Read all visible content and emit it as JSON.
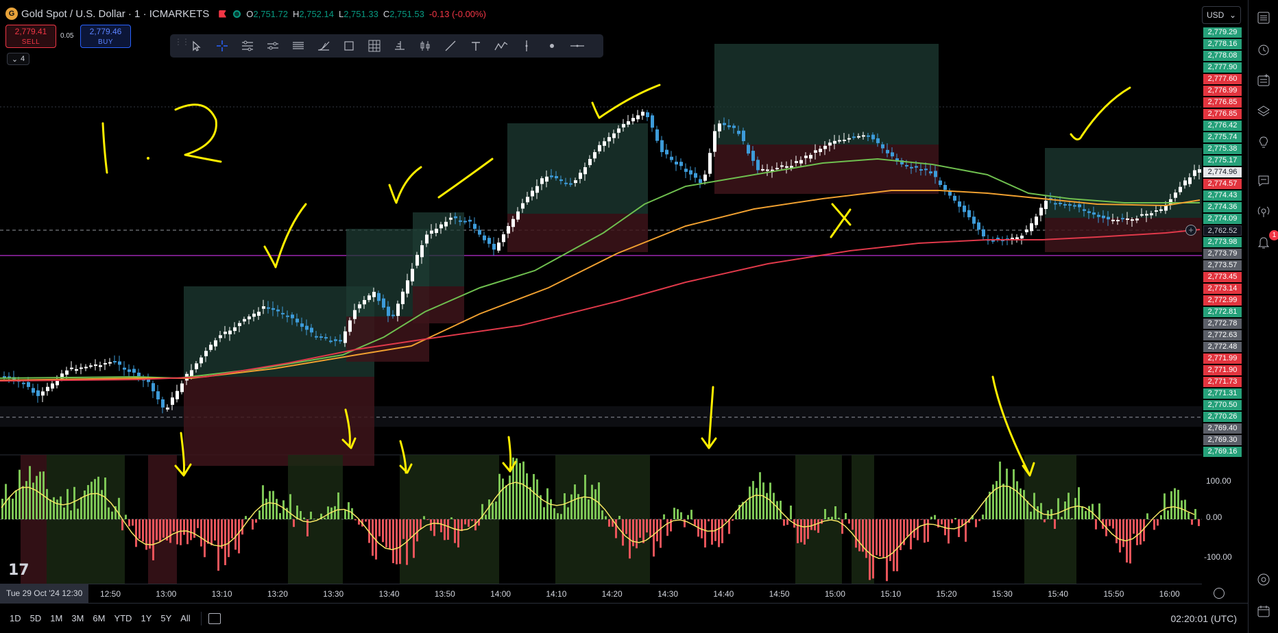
{
  "legend": {
    "symbol": "Gold Spot / U.S. Dollar · 1 · ICMARKETS",
    "open": "2,751.72",
    "high": "2,752.14",
    "low": "2,751.33",
    "close": "2,751.53",
    "change": "-0.13 (-0.00%)"
  },
  "trade": {
    "sell_price": "2,779.41",
    "sell_label": "SELL",
    "buy_price": "2,779.46",
    "buy_label": "BUY",
    "spread": "0.05",
    "collapse_count": "4"
  },
  "currency": "USD",
  "price_labels": [
    {
      "v": "2,779.29",
      "c": "g"
    },
    {
      "v": "2,778.16",
      "c": "g"
    },
    {
      "v": "2,778.08",
      "c": "g"
    },
    {
      "v": "2,777.90",
      "c": "g"
    },
    {
      "v": "2,777.60",
      "c": "r"
    },
    {
      "v": "2,776.99",
      "c": "r"
    },
    {
      "v": "2,776.85",
      "c": "r"
    },
    {
      "v": "2,776.85",
      "c": "r"
    },
    {
      "v": "2,776.42",
      "c": "g"
    },
    {
      "v": "2,775.74",
      "c": "g"
    },
    {
      "v": "2,775.38",
      "c": "g"
    },
    {
      "v": "2,775.17",
      "c": "g"
    },
    {
      "v": "2,774.96",
      "c": "w"
    },
    {
      "v": "2,774.57",
      "c": "r"
    },
    {
      "v": "2,774.43",
      "c": "g"
    },
    {
      "v": "2,774.36",
      "c": "g"
    },
    {
      "v": "2,774.09",
      "c": "g"
    },
    {
      "v": "2,762.52",
      "c": "cur"
    },
    {
      "v": "2,773.98",
      "c": "g"
    },
    {
      "v": "2,773.79",
      "c": "k"
    },
    {
      "v": "2,773.57",
      "c": "k"
    },
    {
      "v": "2,773.45",
      "c": "r"
    },
    {
      "v": "2,773.14",
      "c": "r"
    },
    {
      "v": "2,772.99",
      "c": "r"
    },
    {
      "v": "2,772.81",
      "c": "g"
    },
    {
      "v": "2,772.78",
      "c": "k"
    },
    {
      "v": "2,772.63",
      "c": "k"
    },
    {
      "v": "2,772.48",
      "c": "k"
    },
    {
      "v": "2,771.99",
      "c": "r"
    },
    {
      "v": "2,771.90",
      "c": "r"
    },
    {
      "v": "2,771.73",
      "c": "r"
    },
    {
      "v": "2,771.31",
      "c": "g"
    },
    {
      "v": "2,770.50",
      "c": "g"
    },
    {
      "v": "2,770.26",
      "c": "g"
    },
    {
      "v": "2,769.40",
      "c": "k"
    },
    {
      "v": "2,769.30",
      "c": "k"
    },
    {
      "v": "2,769.16",
      "c": "g"
    }
  ],
  "osc_axis": {
    "top": "100.00",
    "mid": "0.00",
    "bottom": "-100.00"
  },
  "time_axis": {
    "first": "Tue 29 Oct '24   12:30",
    "labels": [
      "12:50",
      "13:00",
      "13:10",
      "13:20",
      "13:30",
      "13:40",
      "13:50",
      "14:00",
      "14:10",
      "14:20",
      "14:30",
      "14:40",
      "14:50",
      "15:00",
      "15:10",
      "15:20",
      "15:30",
      "15:40",
      "15:50",
      "16:00"
    ]
  },
  "ranges": [
    "1D",
    "5D",
    "1M",
    "3M",
    "6M",
    "YTD",
    "1Y",
    "5Y",
    "All"
  ],
  "clock": "02:20:01 (UTC)",
  "notification_count": "1",
  "logo_text": "17",
  "annotation_text": "1 : 2",
  "colors": {
    "up": "#ffffff",
    "down": "#3d9bd9",
    "ema_fast": "#6fbf4f",
    "ema_mid": "#f0a030",
    "ema_slow": "#e0394a",
    "hline": "#9c27b0",
    "osc_pos": "#7cc455",
    "osc_neg": "#e8545a",
    "osc_line": "#f5e663",
    "ink": "#ffee00"
  },
  "icons": [
    "cursor-icon",
    "crosshair-icon",
    "lines-icon",
    "channel-icon",
    "pitchfork-icon",
    "fib-icon",
    "rectangle-icon",
    "grid-icon",
    "ruler-icon",
    "pattern-icon",
    "trendline-icon",
    "text-icon",
    "path-icon",
    "vertical-line-icon",
    "dot-icon",
    "horizontal-line-icon"
  ]
}
